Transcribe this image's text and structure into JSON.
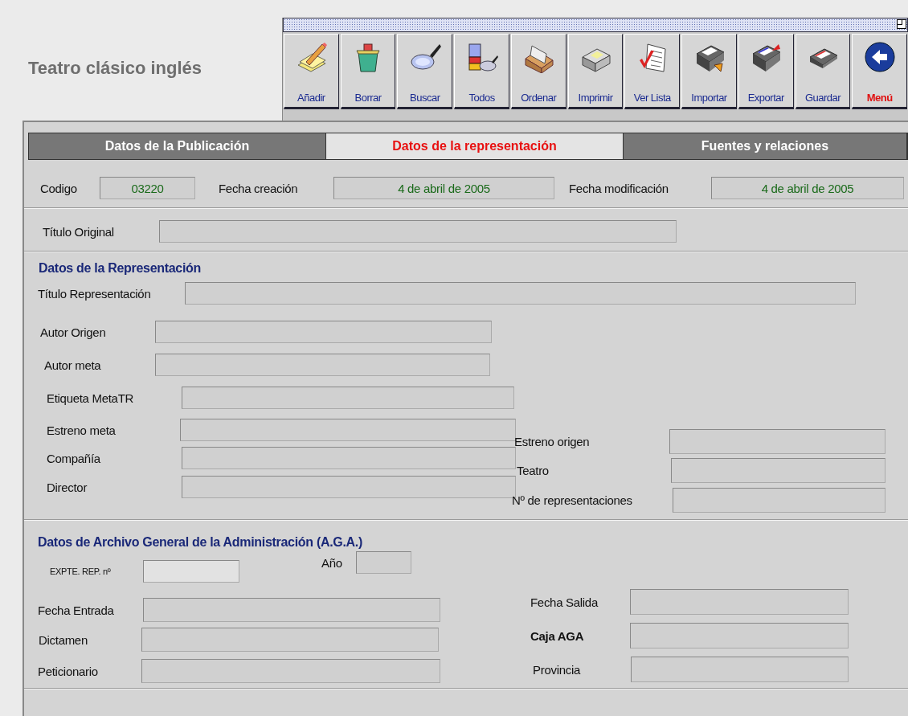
{
  "app_title": "Teatro clásico inglés",
  "toolbar": {
    "buttons": [
      {
        "label": "Añadir",
        "kind": "tool"
      },
      {
        "label": "Borrar",
        "kind": "tool"
      },
      {
        "label": "Buscar",
        "kind": "tool"
      },
      {
        "label": "Todos",
        "kind": "tool"
      },
      {
        "label": "Ordenar",
        "kind": "tool"
      },
      {
        "label": "Imprimir",
        "kind": "tool"
      },
      {
        "label": "Ver Lista",
        "kind": "tool"
      },
      {
        "label": "Importar",
        "kind": "tool"
      },
      {
        "label": "Exportar",
        "kind": "tool"
      },
      {
        "label": "Guardar",
        "kind": "tool"
      },
      {
        "label": "Menú",
        "kind": "menu"
      }
    ]
  },
  "tabs": [
    {
      "label": "Datos de la Publicación",
      "selected": false
    },
    {
      "label": "Datos de la representación",
      "selected": true
    },
    {
      "label": "Fuentes y relaciones",
      "selected": false
    }
  ],
  "header_fields": [
    {
      "label": "Codigo",
      "value": "03220"
    },
    {
      "label": "Fecha creación",
      "value": "4 de abril de 2005"
    },
    {
      "label": "Fecha modificación",
      "value": "4 de abril de 2005"
    }
  ],
  "titulo_original": {
    "label": "Título Original"
  },
  "representacion": {
    "title": "Datos de la Representación",
    "fields": [
      {
        "label": "Título Representación"
      },
      {
        "label": "Autor Origen"
      },
      {
        "label": "Autor meta"
      },
      {
        "label": "Etiqueta MetaTR"
      },
      {
        "label": "Estreno meta"
      },
      {
        "label": "Compañía"
      },
      {
        "label": "Director"
      },
      {
        "label": "Estreno origen"
      },
      {
        "label": "Teatro"
      },
      {
        "label": "Nº de representaciones"
      }
    ]
  },
  "aga": {
    "title": "Datos de Archivo General de la Administración (A.G.A.)",
    "fields": [
      {
        "label": "EXPTE. REP. nº",
        "bold": false
      },
      {
        "label": "Año",
        "bold": false
      },
      {
        "label": "Fecha Entrada",
        "bold": false
      },
      {
        "label": "Dictamen",
        "bold": false
      },
      {
        "label": "Peticionario",
        "bold": false
      },
      {
        "label": "Fecha Salida",
        "bold": false
      },
      {
        "label": "Caja AGA",
        "bold": true
      },
      {
        "label": "Provincia",
        "bold": false
      }
    ]
  }
}
